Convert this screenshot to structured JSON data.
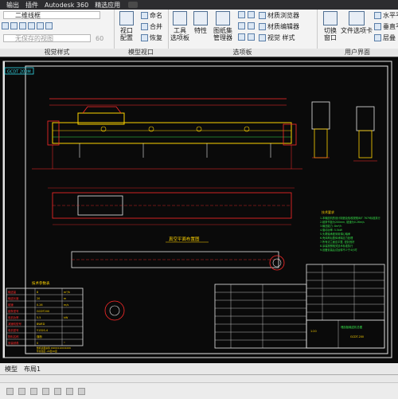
{
  "menu": {
    "items": [
      "输出",
      "插件",
      "Autodesk 360",
      "精选应用"
    ]
  },
  "ribbon": {
    "view_style": {
      "combo_visual_style": "二维线框",
      "combo_layer_value": "无保存的视图",
      "opacity_value": "60",
      "title": "视觉样式"
    },
    "model_viewport": {
      "big_button": "视口\n配置",
      "items": [
        "命名",
        "合并",
        "恢复"
      ],
      "title": "模型视口"
    },
    "palettes": {
      "tool_palettes": "工具\n选项板",
      "properties": "特性",
      "sheet_set": "图纸集\n管理器",
      "materials_browser": "材质浏览器",
      "materials_editor": "材质编辑器",
      "visual_styles": "视觉 样式",
      "title": "选项板"
    },
    "user_interface": {
      "switch_windows": "切换\n窗口",
      "file_tabs": "文件选项卡",
      "tile_horizontal": "水平平",
      "tile_vertical": "垂直平",
      "cascade": "层叠",
      "title": "用户界面"
    }
  },
  "drawing": {
    "viewport_label": "GCDT 200M",
    "section_title": "真空平面布置图",
    "table_title": "技术参数表",
    "tech_notes_title": "技术要求",
    "tech_notes": [
      "1.本输送机的设计制造及验收按照JB/T 7679标准执行",
      "2.链条节距为200mm, 链速为0.26m/s",
      "3.输送能力: 8m³/h",
      "4.驱动功率: 5.5kW",
      "5.头尾轴承座采用调心轴承",
      "6.壳体焊后整体消除应力处理",
      "7.所有法兰面应平整, 密封良好",
      "8.涂装按照相关技术标准执行",
      "9.设备安装后试运转不少于4小时"
    ],
    "params_rows": [
      [
        "输送量",
        "8",
        "m³/h"
      ],
      [
        "输送长度",
        "20",
        "m"
      ],
      [
        "链速",
        "0.26",
        "m/s"
      ],
      [
        "链条型号",
        "GCDT200",
        ""
      ],
      [
        "电机功率",
        "5.5",
        "kW"
      ],
      [
        "减速机型号",
        "BWED",
        ""
      ],
      [
        "电机型号",
        "Y132S-4",
        ""
      ],
      [
        "物料名称",
        "煤粉",
        ""
      ],
      [
        "安装倾角",
        "0",
        "°"
      ]
    ],
    "params_notes": [
      "整机表面涂漆 2900X1100X1006",
      "环境温度 -20至40度"
    ],
    "title_block": {
      "drawing_no": "GCDT-200",
      "name": "埋刮板输送机总图",
      "scale": "1:20"
    }
  },
  "status": {
    "layout_tabs": [
      "模型",
      "布局1"
    ]
  },
  "colors": {
    "canvas": "#0a0a0a",
    "frame": "#e6e6e6",
    "drawing_red": "#ff2a2a",
    "drawing_yellow": "#ffd400",
    "drawing_green": "#37e24a",
    "drawing_cyan": "#32d7e6"
  }
}
